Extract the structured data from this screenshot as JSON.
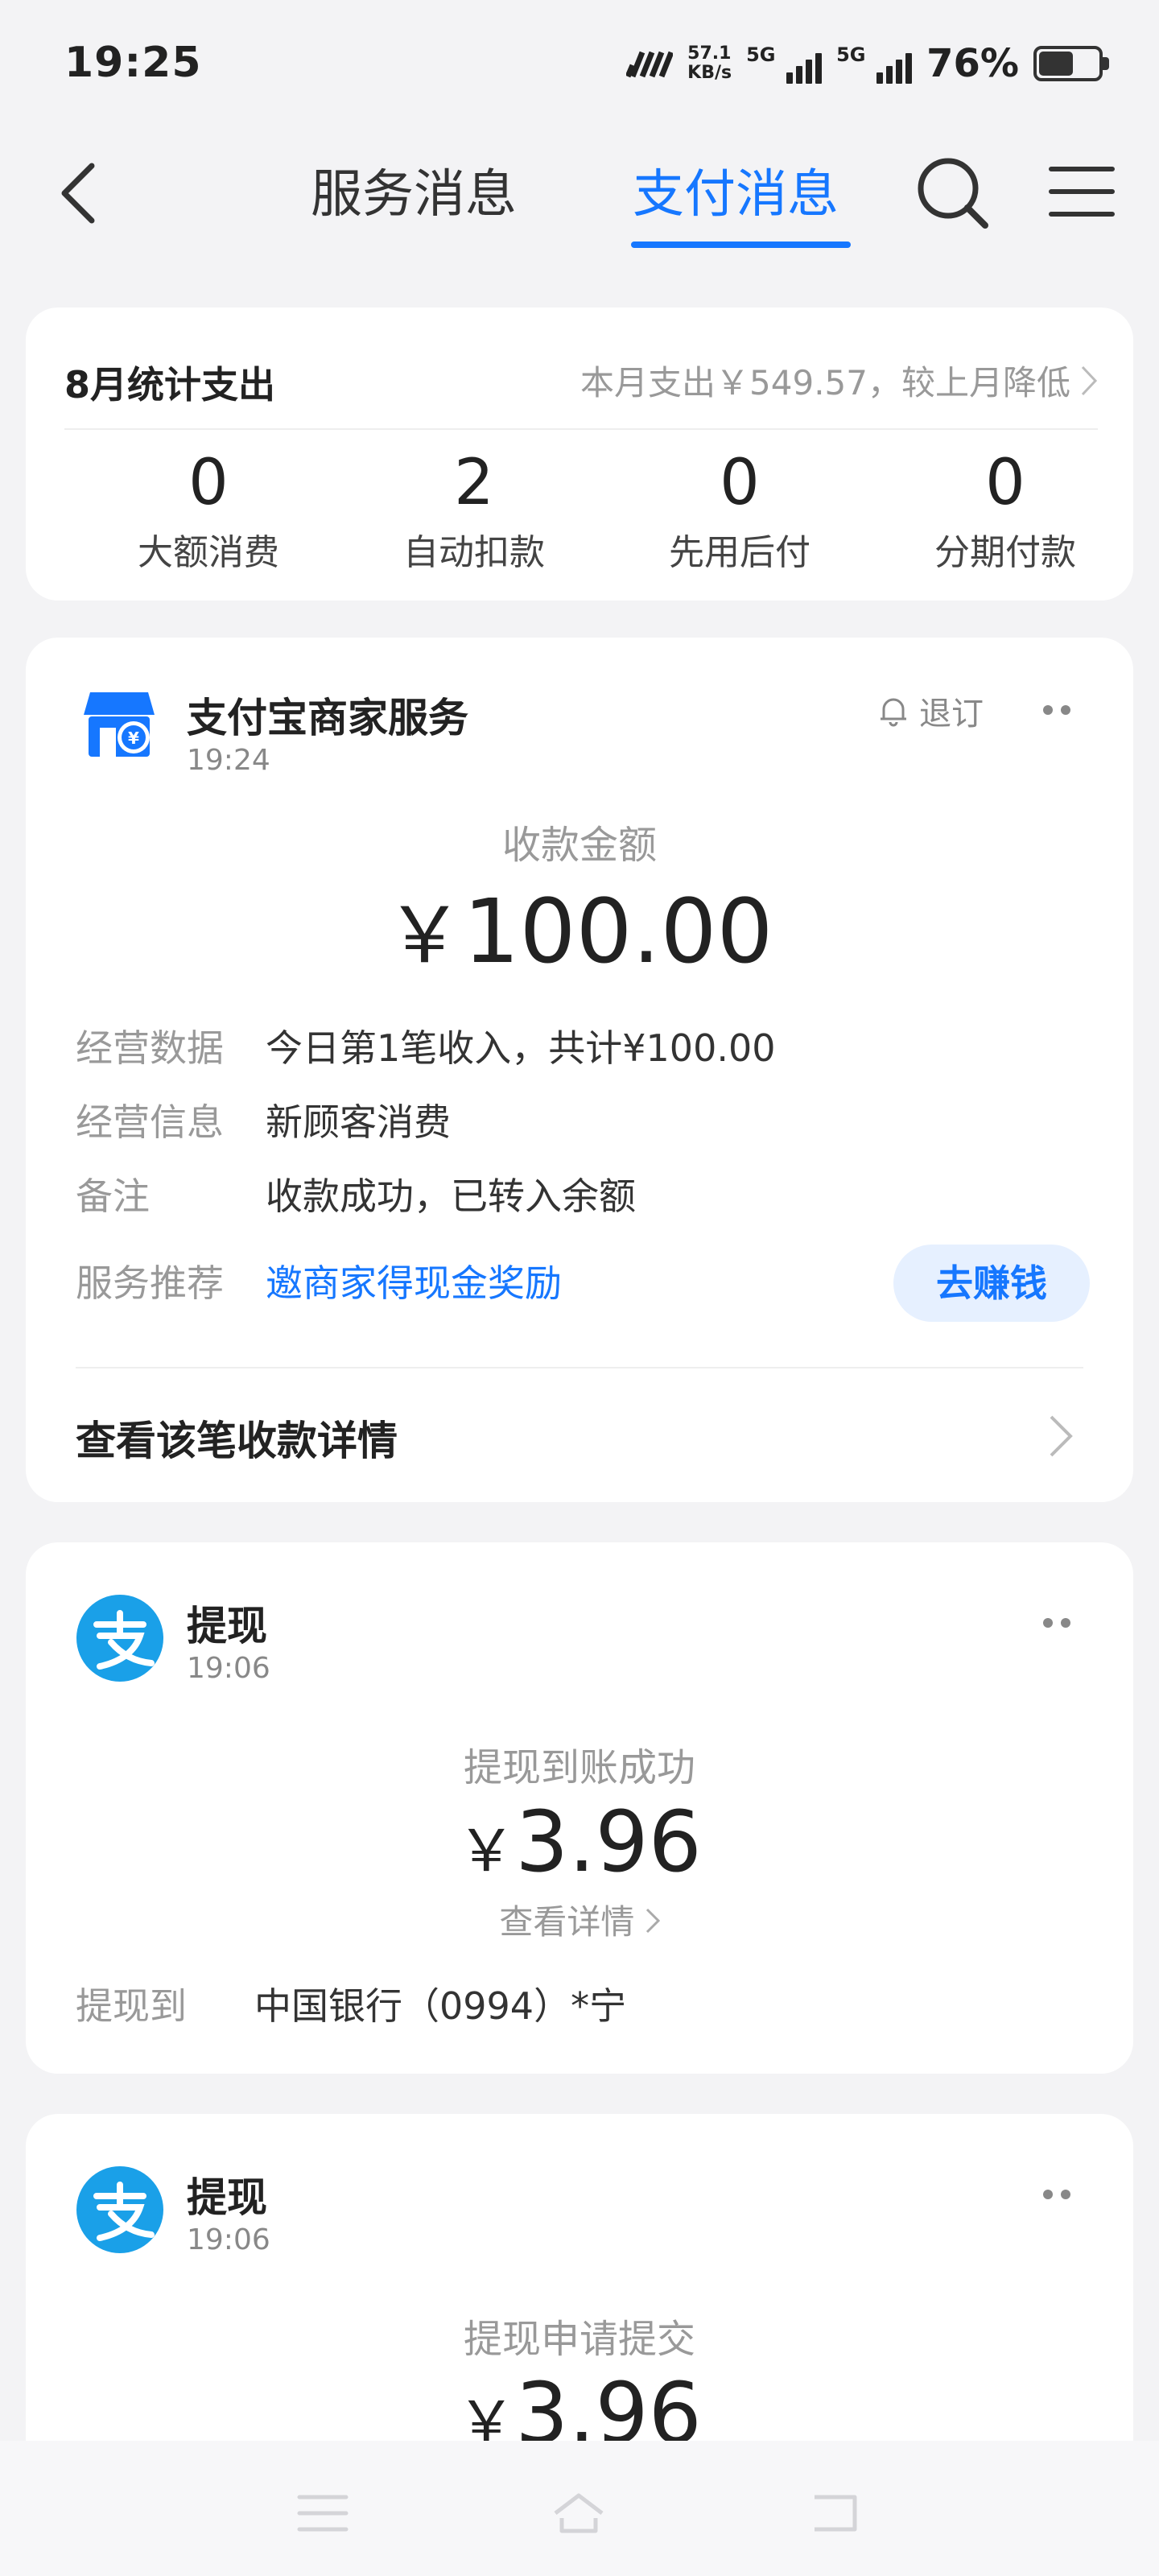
{
  "status_bar": {
    "time": "19:25",
    "net_speed_value": "57.1",
    "net_speed_unit": "KB/s",
    "sig1_tag": "5G",
    "sig2_tag": "5G",
    "battery": "76%"
  },
  "nav": {
    "tab_service": "服务消息",
    "tab_pay": "支付消息"
  },
  "stats": {
    "title": "8月统计支出",
    "summary": "本月支出￥549.57，较上月降低",
    "items": [
      {
        "num": "0",
        "label": "大额消费"
      },
      {
        "num": "2",
        "label": "自动扣款"
      },
      {
        "num": "0",
        "label": "先用后付"
      },
      {
        "num": "0",
        "label": "分期付款"
      }
    ]
  },
  "merchant_card": {
    "name": "支付宝商家服务",
    "time": "19:24",
    "unsubscribe": "退订",
    "amount_label": "收款金额",
    "currency": "￥",
    "amount": "100.00",
    "rows": [
      {
        "label": "经营数据",
        "value": "今日第1笔收入，共计¥100.00"
      },
      {
        "label": "经营信息",
        "value": "新顾客消费"
      },
      {
        "label": "备注",
        "value": "收款成功，已转入余额"
      },
      {
        "label": "服务推荐",
        "value": "邀商家得现金奖励"
      }
    ],
    "earn_button": "去赚钱",
    "detail_link": "查看该笔收款详情"
  },
  "withdraw_cards": [
    {
      "title": "提现",
      "time": "19:06",
      "status": "提现到账成功",
      "currency": "￥",
      "amount": "3.96",
      "link": "查看详情",
      "row_label": "提现到",
      "row_value": "中国银行（0994）*宁"
    },
    {
      "title": "提现",
      "time": "19:06",
      "status": "提现申请提交",
      "currency": "￥",
      "amount": "3.96"
    }
  ],
  "colors": {
    "accent": "#1677ff",
    "background": "#f3f3f5",
    "alipay_blue": "#1aa0e8"
  }
}
